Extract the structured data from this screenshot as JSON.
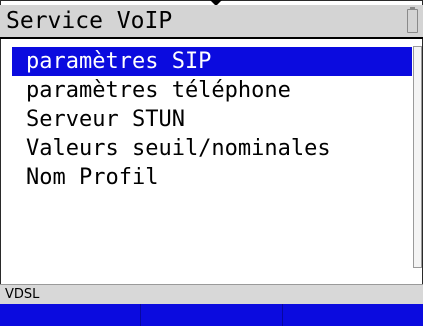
{
  "header": {
    "title": "Service VoIP",
    "battery_icon": "battery-icon"
  },
  "menu": {
    "items": [
      {
        "label": "paramètres SIP",
        "selected": true
      },
      {
        "label": "paramètres téléphone",
        "selected": false
      },
      {
        "label": "Serveur STUN",
        "selected": false
      },
      {
        "label": "Valeurs seuil/nominales",
        "selected": false
      },
      {
        "label": "Nom Profil",
        "selected": false
      }
    ]
  },
  "status": {
    "interface": "VDSL"
  },
  "softkeys": [
    "",
    "",
    ""
  ],
  "colors": {
    "selection": "#0b0bdf",
    "softkey": "#0b0bdf",
    "title_bar": "#d4d4d4",
    "status_bar": "#d8d8d8"
  }
}
